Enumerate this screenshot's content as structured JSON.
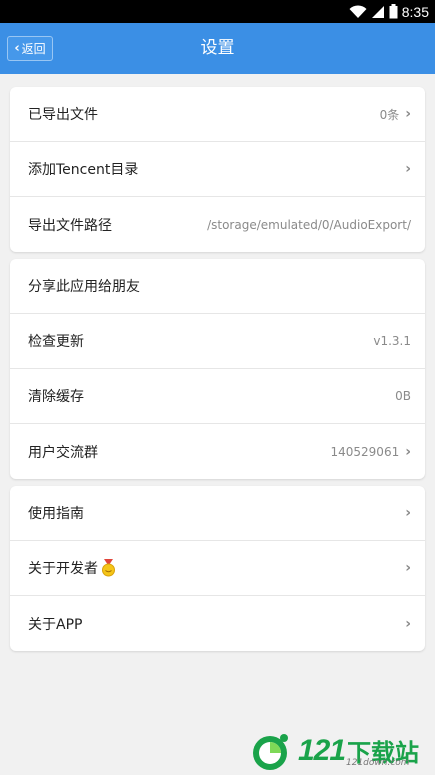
{
  "status_bar": {
    "time": "8:35",
    "icons": [
      "wifi-icon",
      "signal-icon",
      "battery-icon"
    ]
  },
  "app_bar": {
    "back_label": "返回",
    "title": "设置",
    "color": "#3b8fe5"
  },
  "groups": [
    {
      "items": [
        {
          "label": "已导出文件",
          "value": "0条",
          "chevron": true
        },
        {
          "label": "添加Tencent目录",
          "value": "",
          "chevron": true
        },
        {
          "label": "导出文件路径",
          "value": "/storage/emulated/0/AudioExport/",
          "chevron": false
        }
      ]
    },
    {
      "items": [
        {
          "label": "分享此应用给朋友",
          "value": "",
          "chevron": false
        },
        {
          "label": "检查更新",
          "value": "v1.3.1",
          "chevron": false
        },
        {
          "label": "清除缓存",
          "value": "0B",
          "chevron": false
        },
        {
          "label": "用户交流群",
          "value": "140529061",
          "chevron": true
        }
      ]
    },
    {
      "items": [
        {
          "label": "使用指南",
          "value": "",
          "chevron": true
        },
        {
          "label": "关于开发者",
          "value": "",
          "chevron": true,
          "icon": "medal-icon"
        },
        {
          "label": "关于APP",
          "value": "",
          "chevron": true
        }
      ]
    }
  ],
  "watermark": {
    "number": "121",
    "cn": "下载站",
    "sub": "121down.com"
  }
}
